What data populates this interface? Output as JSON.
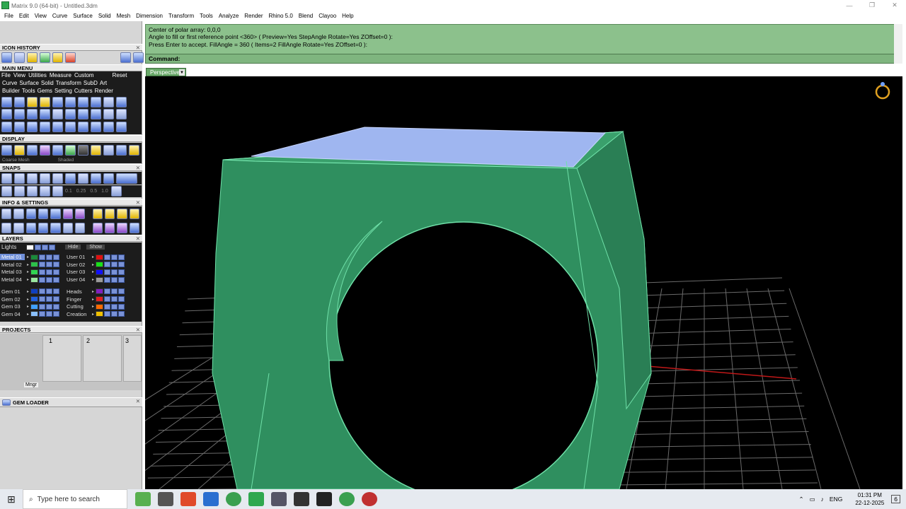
{
  "window": {
    "title": "Matrix 9.0 (64-bit) - Untitled.3dm",
    "min": "—",
    "restore": "❐",
    "close": "✕"
  },
  "menu": [
    "File",
    "Edit",
    "View",
    "Curve",
    "Surface",
    "Solid",
    "Mesh",
    "Dimension",
    "Transform",
    "Tools",
    "Analyze",
    "Render",
    "Rhino 5.0",
    "Blend",
    "Clayoo",
    "Help"
  ],
  "panels": {
    "icon_history": "ICON HISTORY",
    "main_menu": "MAIN MENU",
    "main_menu_items": [
      "File",
      "View",
      "Utilities",
      "Measure",
      "Custom"
    ],
    "reset": "Reset",
    "cat_row1": [
      "Curve",
      "Surface",
      "Solid",
      "Transform",
      "SubD",
      "Art"
    ],
    "cat_row2": [
      "Builder",
      "Tools",
      "Gems",
      "Setting",
      "Cutters",
      "Render"
    ],
    "display": "DISPLAY",
    "mesh_mode": "Coarse Mesh",
    "shade_mode": "Shaded",
    "snaps": "SNAPS",
    "snap_values": [
      "0.1",
      "0.25",
      "0.5",
      "1.0"
    ],
    "info_settings": "INFO & SETTINGS",
    "layers": "LAYERS",
    "lights": "Lights",
    "hide": "Hide",
    "show": "Show",
    "layers_left": [
      "Metal 01",
      "Metal 02",
      "Metal 03",
      "Metal 04",
      "Gem 01",
      "Gem 02",
      "Gem 03",
      "Gem 04"
    ],
    "layers_right": [
      "User 01",
      "User 02",
      "User 03",
      "User 04",
      "Heads",
      "Finger",
      "Cutting",
      "Creation"
    ],
    "layer_colors_left": [
      "#1a8a3a",
      "#2cc04a",
      "#31d552",
      "#9ae8a0",
      "#1040c0",
      "#2060e0",
      "#40a0ff",
      "#8ac0ff"
    ],
    "layer_colors_right": [
      "#e01010",
      "#18e018",
      "#1010ff",
      "#9a9a9a",
      "#8020c0",
      "#e02020",
      "#ff6a00",
      "#f0c000"
    ],
    "projects": "PROJECTS",
    "project_slots": [
      "1",
      "2",
      "3"
    ],
    "mngr": "Mngr",
    "gem_loader": "GEM LOADER"
  },
  "command": {
    "line1": "Center of polar array: 0,0,0",
    "line2": "Angle to fill or first reference point <360> ( Preview=Yes  StepAngle  Rotate=Yes  ZOffset=0 ):",
    "line3": "Press Enter to accept. FillAngle = 360 ( Items=2  FillAngle  Rotate=Yes  ZOffset=0 ):",
    "prompt": "Command:"
  },
  "viewport": {
    "name": "Perspective",
    "ring_color": "#2e8a5c",
    "gem_color": "#9fb6f0",
    "grid_color": "#7a7a7a"
  },
  "taskbar": {
    "search_placeholder": "Type here to search",
    "lang": "ENG",
    "time": "01:31 PM",
    "date": "22-12-2025",
    "notif": "6"
  }
}
